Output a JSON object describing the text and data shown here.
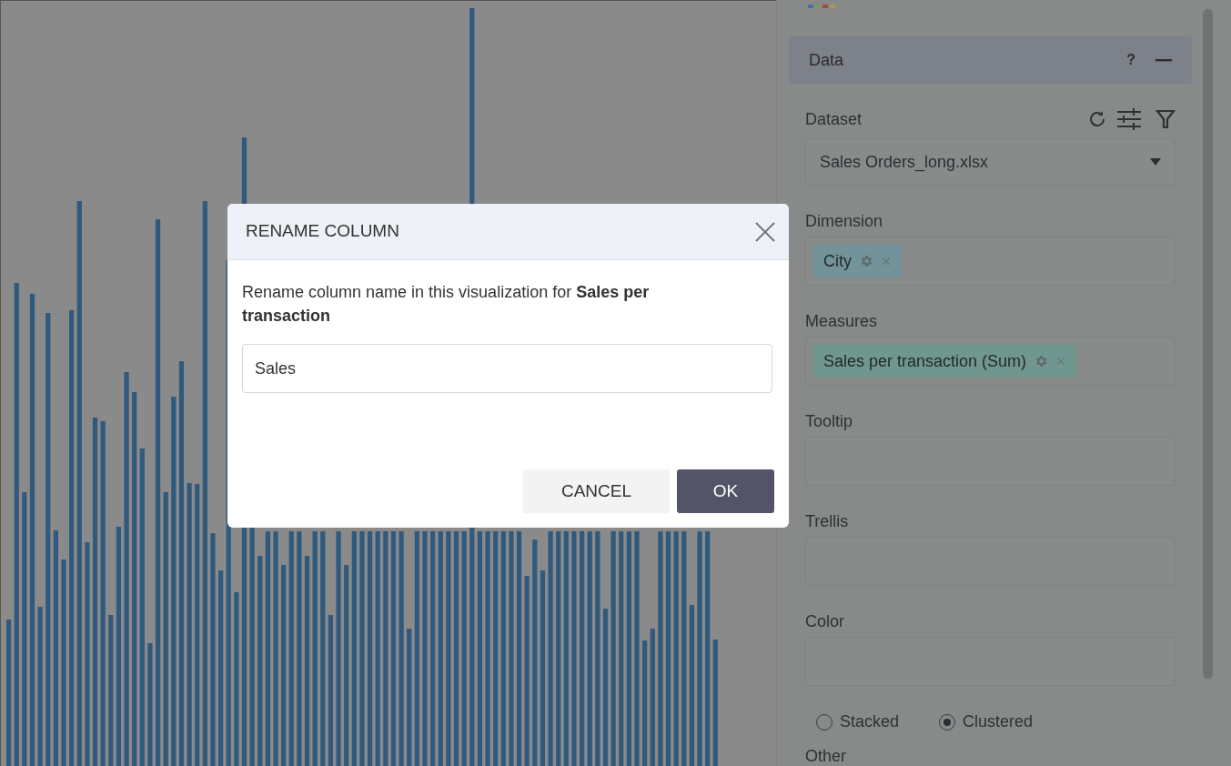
{
  "panel": {
    "section": {
      "title": "Data",
      "help": "?"
    },
    "dataset": {
      "label": "Dataset",
      "value": "Sales Orders_long.xlsx"
    },
    "wells": [
      {
        "label": "Dimension",
        "chips": [
          {
            "label": "City"
          }
        ]
      },
      {
        "label": "Measures",
        "chips": [
          {
            "label": "Sales per transaction (Sum)"
          }
        ]
      },
      {
        "label": "Tooltip"
      },
      {
        "label": "Trellis"
      },
      {
        "label": "Color"
      }
    ],
    "bar_mode": [
      {
        "label": "Stacked",
        "selected": false
      },
      {
        "label": "Clustered",
        "selected": true
      }
    ],
    "other_label": "Other"
  },
  "dialog": {
    "title": "RENAME COLUMN",
    "message": "Rename column name in this visualization for **Sales per transaction**",
    "value": "Sales",
    "buttons": [
      {
        "label": "CANCEL",
        "kind": "secondary"
      },
      {
        "label": "OK",
        "kind": "primary"
      }
    ]
  }
}
